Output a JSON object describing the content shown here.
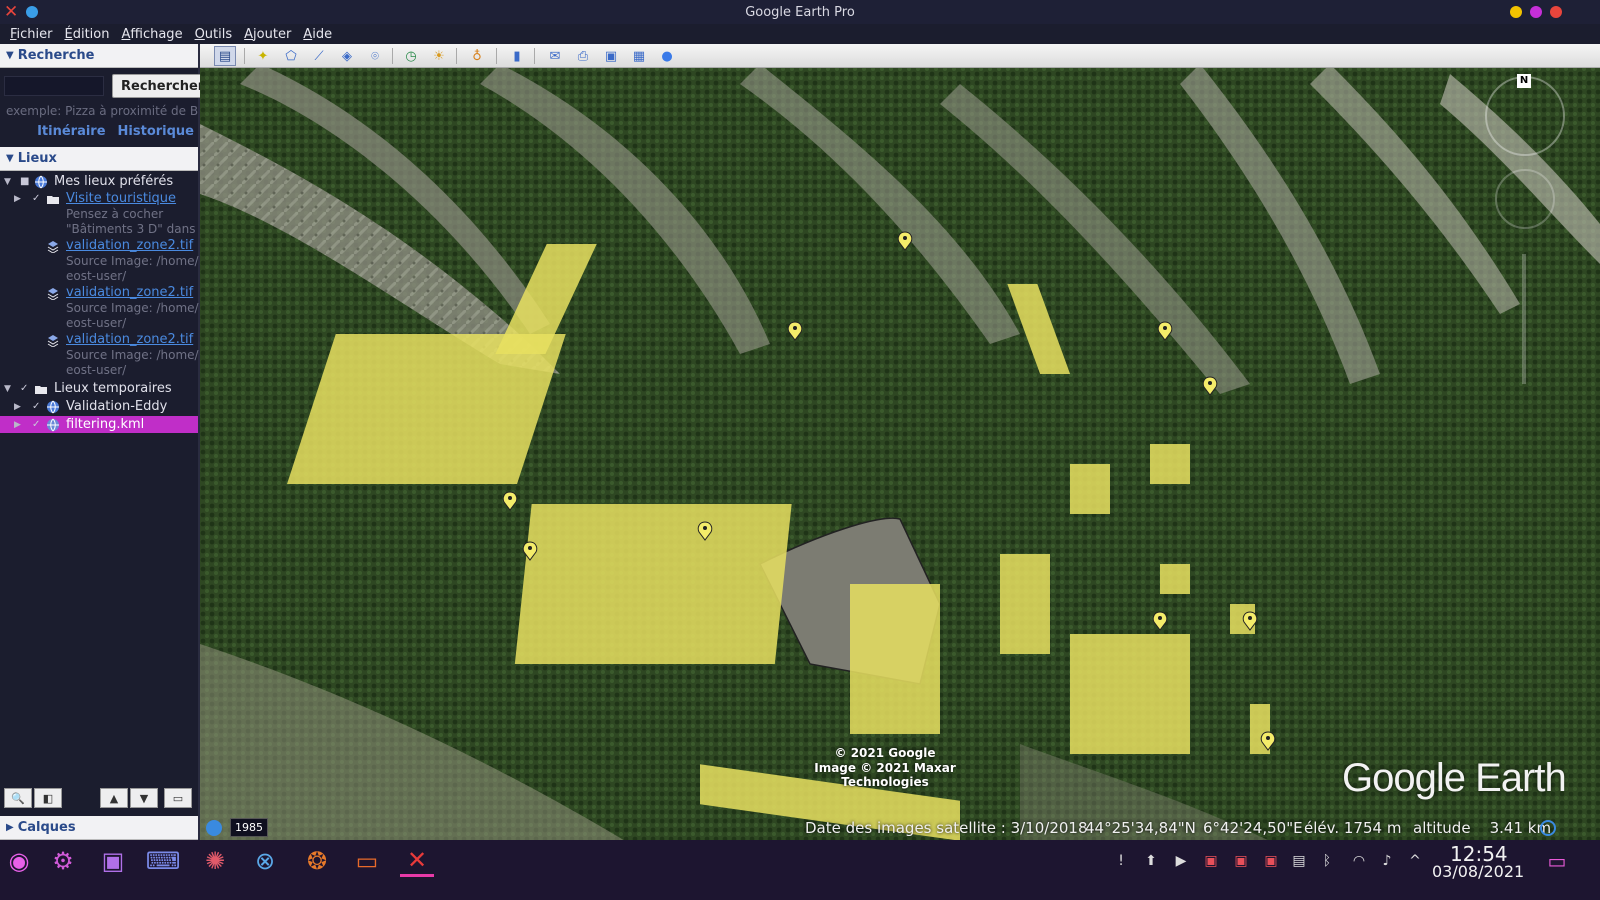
{
  "window": {
    "title": "Google Earth Pro"
  },
  "menu": [
    "Fichier",
    "Édition",
    "Affichage",
    "Outils",
    "Ajouter",
    "Aide"
  ],
  "search": {
    "header": "Recherche",
    "button": "Rechercher",
    "placeholder": "",
    "hint": "exemple: Pizza à proximité de Bre",
    "links": [
      "Itinéraire",
      "Historique"
    ]
  },
  "places": {
    "header": "Lieux",
    "favorites": "Mes lieux préférés",
    "tour_folder": "Visite touristique",
    "tour_hint_1": "Pensez à cocher",
    "tour_hint_2": "\"Bâtiments 3 D\" dans",
    "overlays": [
      {
        "name": "validation_zone2.tif",
        "src1": "Source Image: /home/",
        "src2": "eost-user/"
      },
      {
        "name": "validation_zone2.tif",
        "src1": "Source Image: /home/",
        "src2": "eost-user/"
      },
      {
        "name": "validation_zone2.tif",
        "src1": "Source Image: /home/",
        "src2": "eost-user/"
      }
    ],
    "temp": "Lieux temporaires",
    "temp_items": [
      "Validation-Eddy",
      "filtering.kml"
    ]
  },
  "layers": {
    "header": "Calques"
  },
  "map": {
    "historical_year": "1985",
    "copyright_1": "© 2021 Google",
    "copyright_2": "Image © 2021 Maxar Technologies",
    "logo": "Google Earth",
    "compass_label": "N"
  },
  "status": {
    "imagery_date": "Date des images satellite : 3/10/2018",
    "lat": "44°25'34,84\"N",
    "lon": "6°42'24,50\"E",
    "elev": "élév. 1754 m",
    "alt": "altitude    3.41 km"
  },
  "clock": {
    "time": "12:54",
    "date": "03/08/2021"
  },
  "colors": {
    "selection": "#c02ec8",
    "placemark": "#f4ec6a",
    "terrain_forest": "#2c4620",
    "terrain_rock": "#9a9a8e"
  }
}
